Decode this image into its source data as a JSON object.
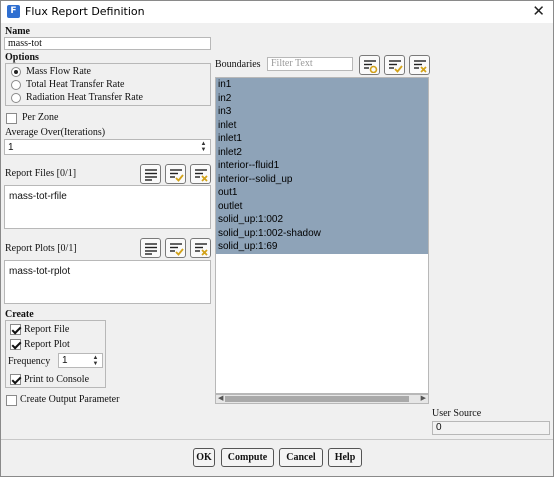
{
  "window": {
    "title": "Flux Report Definition",
    "app_icon_letter": "F",
    "close_glyph": "✕"
  },
  "name": {
    "label": "Name",
    "value": "mass-tot"
  },
  "options": {
    "label": "Options",
    "items": [
      {
        "label": "Mass Flow Rate",
        "selected": true
      },
      {
        "label": "Total Heat Transfer Rate",
        "selected": false
      },
      {
        "label": "Radiation Heat Transfer Rate",
        "selected": false
      }
    ]
  },
  "per_zone": {
    "label": "Per Zone",
    "checked": false
  },
  "average_over": {
    "label": "Average Over(Iterations)",
    "value": "1"
  },
  "report_files": {
    "label": "Report Files [0/1]",
    "items": [
      "mass-tot-rfile"
    ]
  },
  "report_plots": {
    "label": "Report Plots [0/1]",
    "items": [
      "mass-tot-rplot"
    ]
  },
  "create": {
    "label": "Create",
    "report_file": {
      "label": "Report File",
      "checked": true
    },
    "report_plot": {
      "label": "Report Plot",
      "checked": true
    },
    "frequency": {
      "label": "Frequency",
      "value": "1"
    },
    "print_to_console": {
      "label": "Print to Console",
      "checked": true
    }
  },
  "create_output_parameter": {
    "label": "Create Output Parameter",
    "checked": false
  },
  "boundaries": {
    "label": "Boundaries",
    "filter_placeholder": "Filter Text",
    "items": [
      "in1",
      "in2",
      "in3",
      "inlet",
      "inlet1",
      "inlet2",
      "interior--fluid1",
      "interior--solid_up",
      "out1",
      "outlet",
      "solid_up:1:002",
      "solid_up:1:002-shadow",
      "solid_up:1:69"
    ],
    "selected_color": "#8ea3b8"
  },
  "user_source": {
    "label": "User Source",
    "value": "0"
  },
  "buttons": {
    "ok": "OK",
    "compute": "Compute",
    "cancel": "Cancel",
    "help": "Help"
  },
  "icons": {
    "select_all": "select-all-icon",
    "check_list": "check-list-icon",
    "clear_list": "clear-list-icon",
    "filter_settings": "filter-settings-icon"
  }
}
